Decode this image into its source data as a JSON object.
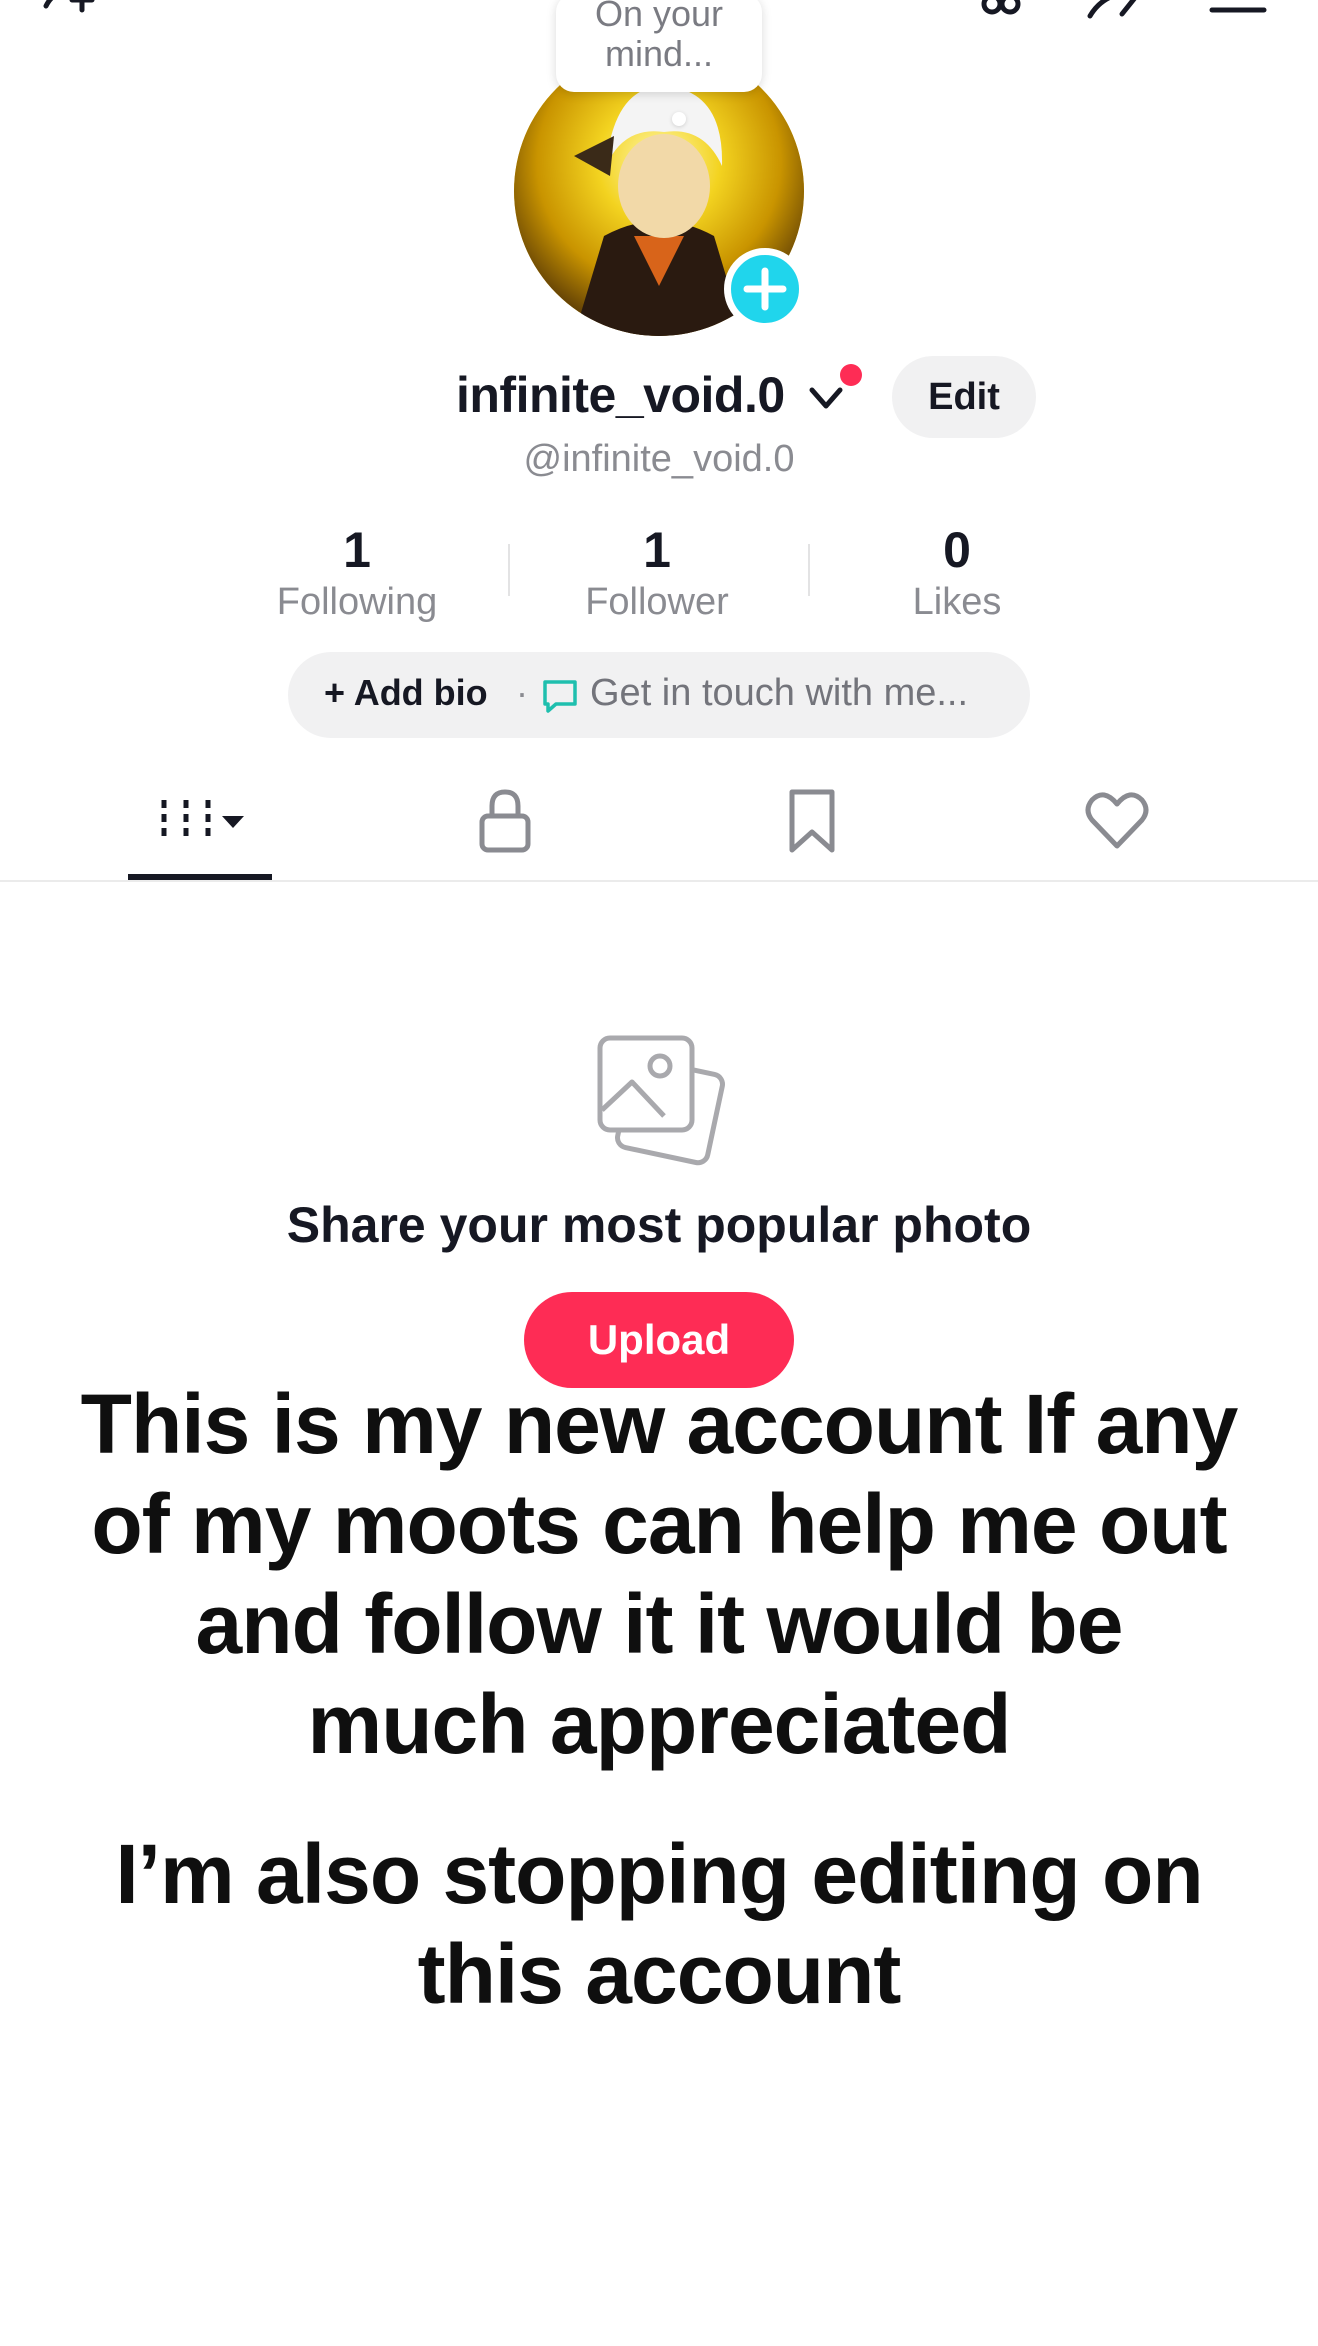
{
  "header": {
    "icons": [
      "add-friend-icon",
      "creator-tools-icon",
      "share-icon",
      "menu-icon"
    ]
  },
  "profile": {
    "note_bubble": "On your mind...",
    "display_name": "infinite_void.0",
    "handle": "@infinite_void.0",
    "edit_label": "Edit",
    "accent_color": "#20d5ec",
    "notification_color": "#fe2c55"
  },
  "stats": [
    {
      "value": "1",
      "label": "Following"
    },
    {
      "value": "1",
      "label": "Follower"
    },
    {
      "value": "0",
      "label": "Likes"
    }
  ],
  "bio": {
    "add_label": "+ Add bio",
    "separator": "·",
    "contact_label": "Get in touch with me..."
  },
  "tabs": [
    "videos-grid-icon",
    "private-lock-icon",
    "saved-bookmark-icon",
    "liked-heart-icon"
  ],
  "empty_state": {
    "title": "Share your most popular photo",
    "upload_label": "Upload",
    "upload_color": "#fe2c55"
  },
  "caption": {
    "line1": "This is my new account If any of my moots can help me out and follow it it would be much appreciated",
    "line2": "I’m also stopping editing on this account"
  }
}
